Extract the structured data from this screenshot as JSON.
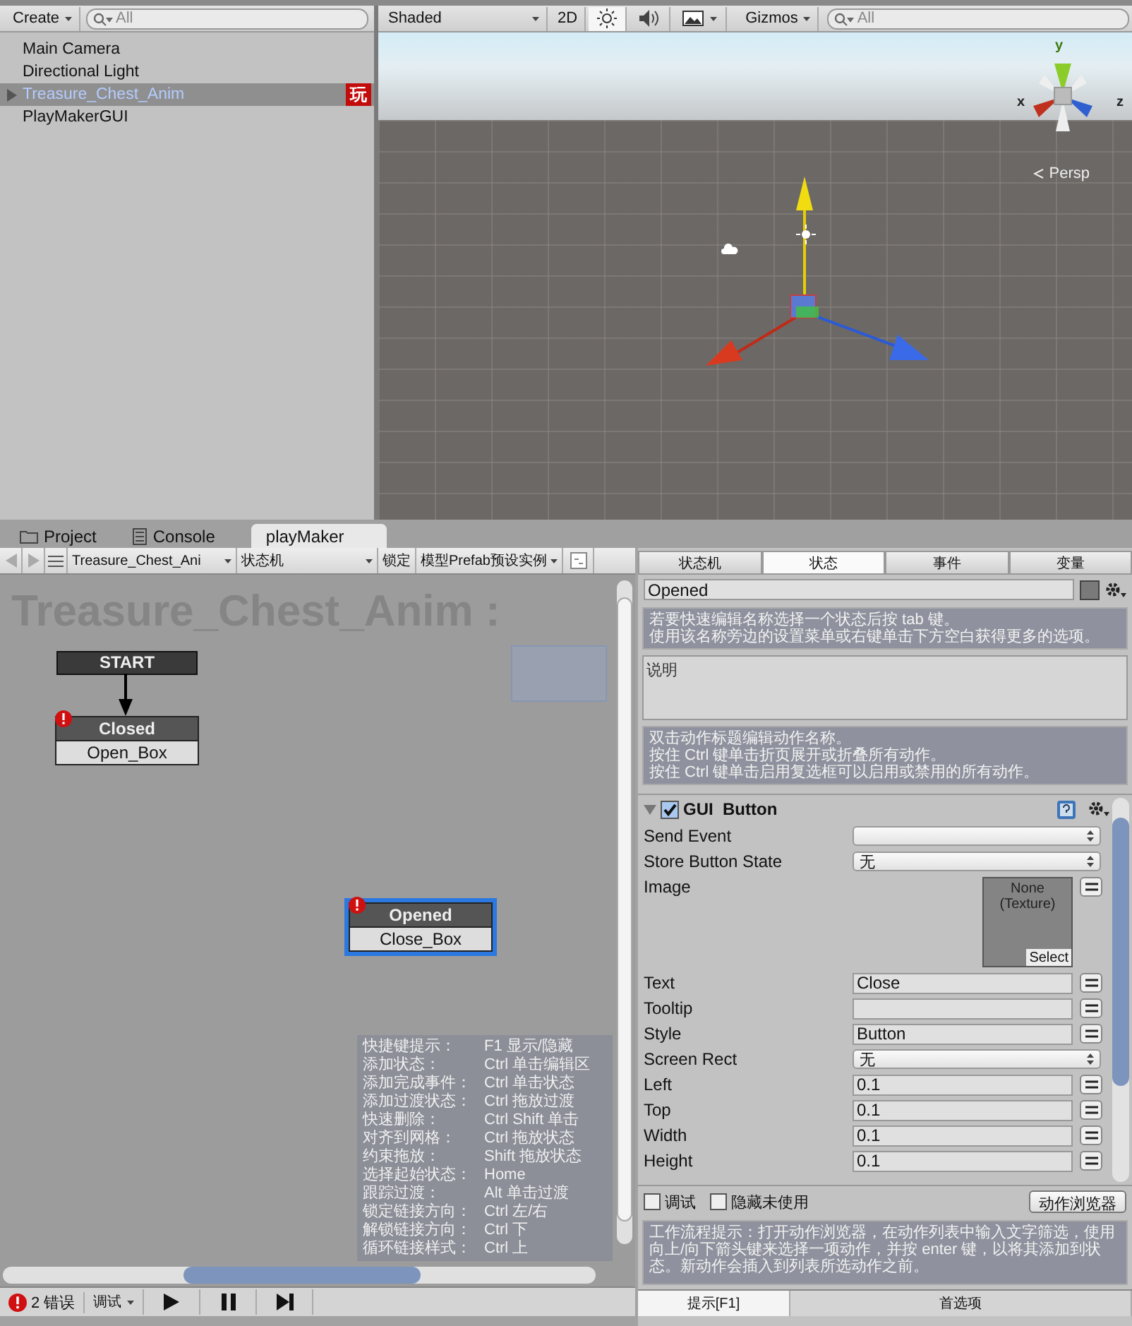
{
  "hierarchy": {
    "create_button": "Create",
    "search": {
      "placeholder": "All"
    },
    "items": [
      {
        "label": "Main Camera",
        "selected": false,
        "expandable": false
      },
      {
        "label": "Directional Light",
        "selected": false,
        "expandable": false
      },
      {
        "label": "Treasure_Chest_Anim",
        "selected": true,
        "expandable": true,
        "badge": "玩"
      },
      {
        "label": "PlayMakerGUI",
        "selected": false,
        "expandable": false
      }
    ]
  },
  "scene": {
    "toolbar": {
      "shading": "Shaded",
      "mode_2d": "2D",
      "lighting_on": true,
      "audio_on": false,
      "effects_on": false,
      "gizmos": "Gizmos",
      "search": {
        "placeholder": "All"
      }
    },
    "axis_labels": {
      "y": "y",
      "x": "x",
      "z": "z"
    },
    "projection": "Persp"
  },
  "bottom_tabs": [
    {
      "label": "Project",
      "selected": false,
      "kind": "folder"
    },
    {
      "label": "Console",
      "selected": false,
      "kind": "console"
    },
    {
      "label": "playMaker",
      "selected": true,
      "kind": "plain"
    }
  ],
  "playmaker": {
    "toolbar": {
      "fsm_owner": "Treasure_Chest_Ani",
      "fsm": "状态机",
      "lock": "锁定",
      "prefab": "模型Prefab预设实例"
    },
    "graph": {
      "title": "Treasure_Chest_Anim :",
      "start": "START",
      "states": [
        {
          "name": "Closed",
          "transition": "Open_Box",
          "error": true,
          "selected": false
        },
        {
          "name": "Opened",
          "transition": "Close_Box",
          "error": true,
          "selected": true
        }
      ],
      "hints": [
        {
          "action": "快捷键提示：",
          "keys": "F1 显示/隐藏"
        },
        {
          "action": "添加状态：",
          "keys": "Ctrl 单击编辑区"
        },
        {
          "action": "添加完成事件：",
          "keys": "Ctrl 单击状态"
        },
        {
          "action": "添加过渡状态：",
          "keys": "Ctrl 拖放过渡"
        },
        {
          "action": "快速删除：",
          "keys": "Ctrl Shift 单击"
        },
        {
          "action": "对齐到网格：",
          "keys": "Ctrl 拖放状态"
        },
        {
          "action": "约束拖放：",
          "keys": "Shift 拖放状态"
        },
        {
          "action": "选择起始状态：",
          "keys": "Home"
        },
        {
          "action": "跟踪过渡：",
          "keys": "Alt 单击过渡"
        },
        {
          "action": "锁定链接方向：",
          "keys": "Ctrl 左/右"
        },
        {
          "action": "解锁链接方向：",
          "keys": "Ctrl 下"
        },
        {
          "action": "循环链接样式：",
          "keys": "Ctrl 上"
        }
      ]
    },
    "status": {
      "errors": "2 错误",
      "debug": "调试"
    },
    "inspector": {
      "tabs": [
        {
          "label": "状态机",
          "selected": false
        },
        {
          "label": "状态",
          "selected": true
        },
        {
          "label": "事件",
          "selected": false
        },
        {
          "label": "变量",
          "selected": false
        }
      ],
      "state_name": "Opened",
      "name_hint": [
        "若要快速编辑名称选择一个状态后按 tab 键。",
        "使用该名称旁边的设置菜单或右键单击下方空白获得更多的选项。"
      ],
      "description": {
        "placeholder": "说明"
      },
      "action_hint": [
        "双击动作标题编辑动作名称。",
        "按住 Ctrl 键单击折页展开或折叠所有动作。",
        "按住 Ctrl 键单击启用复选框可以启用或禁用的所有动作。"
      ],
      "action": {
        "title": "GUI  Button",
        "enabled": true,
        "expanded": true,
        "params": [
          {
            "label": "Send Event",
            "kind": "dropdown"
          },
          {
            "label": "Store Button State",
            "kind": "dropdown",
            "value": "无"
          },
          {
            "label": "Image",
            "kind": "texture",
            "value": "None (Texture)",
            "select": "Select"
          },
          {
            "label": "Text",
            "kind": "field",
            "value": "Close"
          },
          {
            "label": "Tooltip",
            "kind": "field"
          },
          {
            "label": "Style",
            "kind": "field",
            "value": "Button"
          },
          {
            "label": "Screen Rect",
            "kind": "dropdown",
            "value": "无"
          },
          {
            "label": "Left",
            "kind": "field",
            "value": "0.1"
          },
          {
            "label": "Top",
            "kind": "field",
            "value": "0.1"
          },
          {
            "label": "Width",
            "kind": "field",
            "value": "0.1"
          },
          {
            "label": "Height",
            "kind": "field",
            "value": "0.1"
          }
        ]
      },
      "options": [
        {
          "label": "调试",
          "checked": false
        },
        {
          "label": "隐藏未使用",
          "checked": false
        }
      ],
      "action_browser": "动作浏览器",
      "workflow_hint": "工作流程提示：打开动作浏览器，在动作列表中输入文字筛选，使用向上/向下箭头键来选择一项动作，并按 enter 键，以将其添加到状态。新动作会插入到列表所选动作之前。",
      "footer_tabs": [
        {
          "label": "提示[F1]",
          "selected": true
        },
        {
          "label": "首选项",
          "selected": false
        }
      ]
    }
  }
}
